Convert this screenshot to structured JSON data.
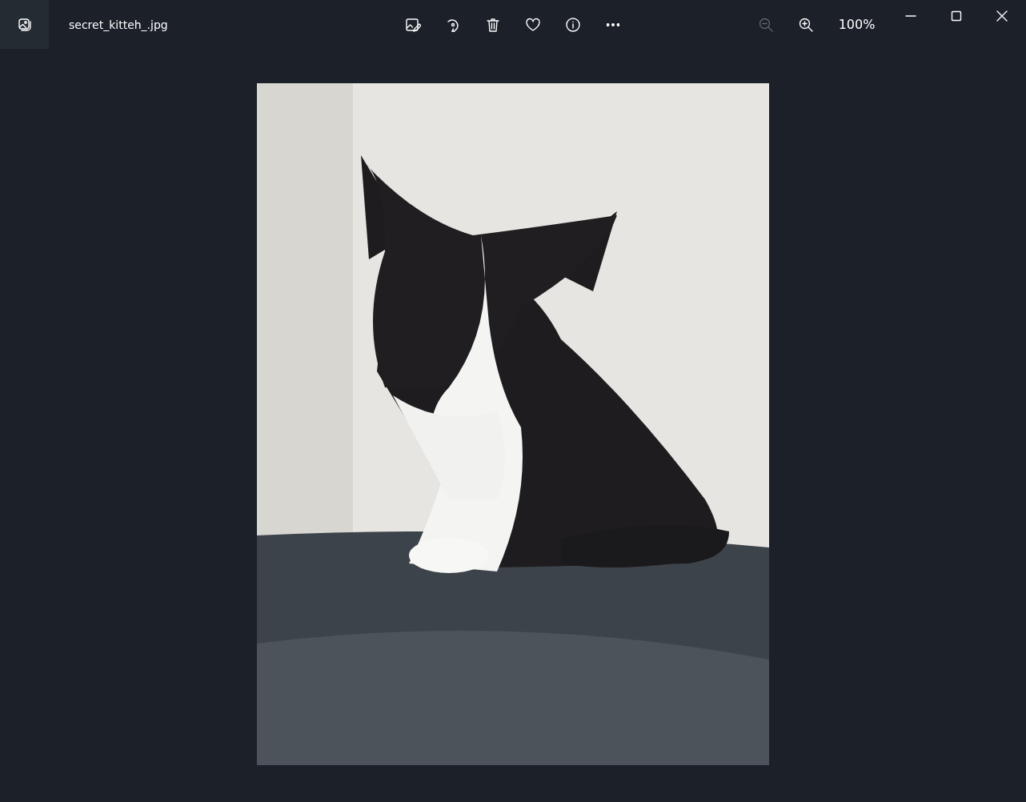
{
  "window": {
    "title": "secret_kitteh_.jpg"
  },
  "zoom_out": {
    "disabled": true
  },
  "zoom_in": {
    "disabled": false
  },
  "zoom_level": "100%"
}
